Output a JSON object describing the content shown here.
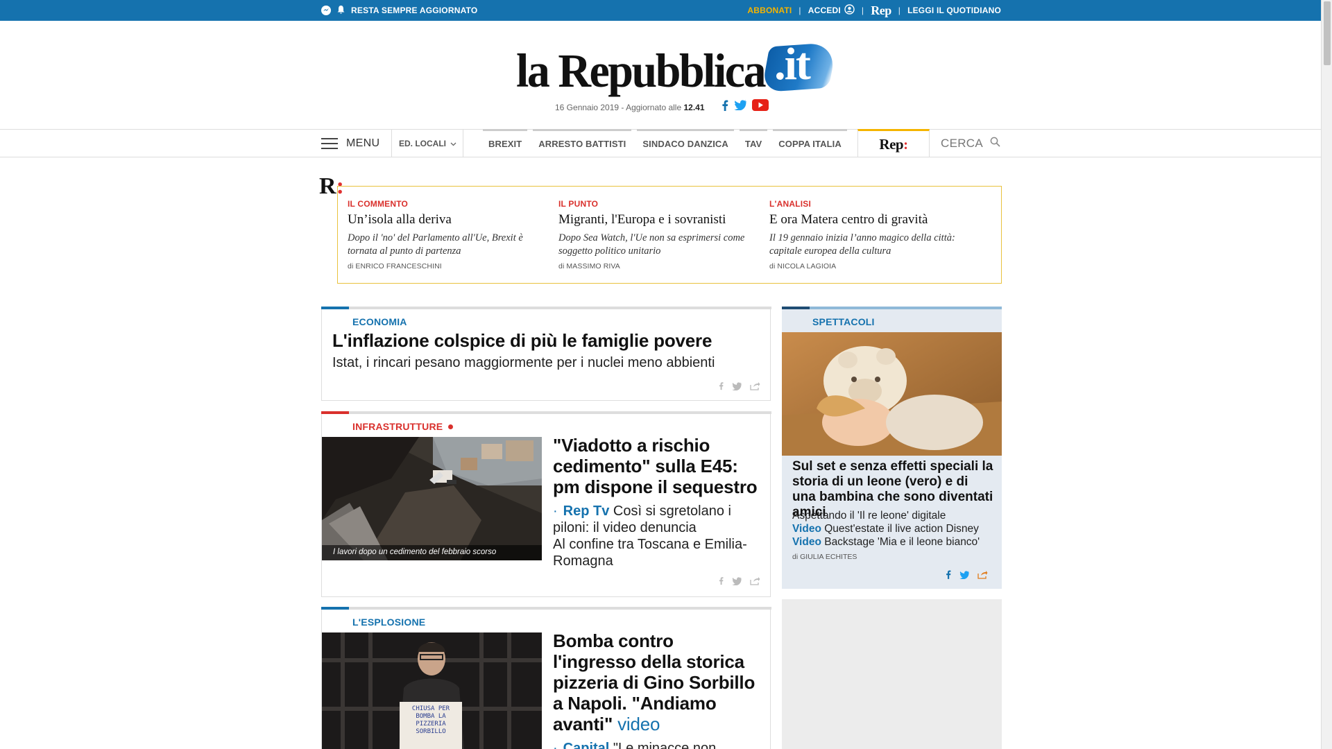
{
  "topbar": {
    "resta": "RESTA SEMPRE AGGIORNATO",
    "abbonati": "ABBONATI",
    "accedi": "ACCEDI",
    "rep": "Rep",
    "leggi": "LEGGI IL QUOTIDIANO",
    "sep": "|"
  },
  "logo": {
    "word": "la Repubblica",
    "suffix": ".it"
  },
  "dateline": {
    "date": "16 Gennaio 2019 - Aggiornato alle ",
    "time": "12.41"
  },
  "nav": {
    "menu": "MENU",
    "ed_locali": "ED. LOCALI",
    "topics": [
      "BREXIT",
      "ARRESTO BATTISTI",
      "SINDACO DANZICA",
      "TAV",
      "COPPA ITALIA"
    ],
    "rep": "Rep",
    "rep_colon": ":",
    "cerca": "CERCA"
  },
  "rep_box": {
    "mark": "R",
    "mark_colon": ":",
    "items": [
      {
        "kicker": "IL COMMENTO",
        "title": "Un’isola alla deriva",
        "desc": "Dopo il 'no' del Parlamento all'Ue, Brexit è tornata al punto di partenza",
        "by_prefix": "di ",
        "author": "ENRICO FRANCESCHINI"
      },
      {
        "kicker": "IL PUNTO",
        "title": "Migranti, l'Europa e i sovranisti",
        "desc": "Dopo Sea Watch, l'Ue non sa esprimersi come soggetto politico unitario",
        "by_prefix": "di ",
        "author": "MASSIMO RIVA"
      },
      {
        "kicker": "L'ANALISI",
        "title": "E ora Matera centro di gravità",
        "desc": "Il 19 gennaio inizia l’anno magico della città: capitale europea della cultura",
        "by_prefix": "di ",
        "author": "NICOLA LAGIOIA"
      }
    ]
  },
  "articles": [
    {
      "kicker": "ECONOMIA",
      "headline": "L'inflazione colspice di più le famiglie povere",
      "sub": "Istat, i rincari pesano maggiormente per i nuclei meno abbienti"
    },
    {
      "kicker": "INFRASTRUTTURE",
      "caption": "I lavori dopo un cedimento del febbraio scorso",
      "headline": "\"Viadotto a rischio cedimento\" sulla E45: pm dispone il sequestro",
      "bullet_link": "Rep Tv",
      "bullet_text": " Così si sgretolano i piloni: il video denuncia",
      "extra": "Al confine tra Toscana e Emilia-Romagna"
    },
    {
      "kicker": "L'ESPLOSIONE",
      "headline": "Bomba contro l'ingresso della storica pizzeria di Gino Sorbillo a Napoli. \"Andiamo avanti\"",
      "headline_link": "video",
      "bullet_link": "Capital",
      "bullet_text": " \"Le minacce non funzionano: se mollo io, molla",
      "sign_text": "CHIUSA PER BOMBA LA PIZZERIA SORBILLO"
    }
  ],
  "side": {
    "kicker": "SPETTACOLI",
    "headline": "Sul set e senza effetti speciali la storia di un leone (vero) e di una bambina che sono diventati amici",
    "line1": "Aspettando il 'Il re leone' digitale",
    "line2_link": "Video",
    "line2_text": " Quest'estate il live action Disney",
    "line3_link": "Video",
    "line3_text": " Backstage 'Mia e il leone bianco'",
    "by_prefix": "di ",
    "author": "GIULIA ECHITES"
  },
  "colors": {
    "brand_blue": "#1572ae",
    "accent_red": "#d9302c",
    "gold": "#f5b400"
  }
}
